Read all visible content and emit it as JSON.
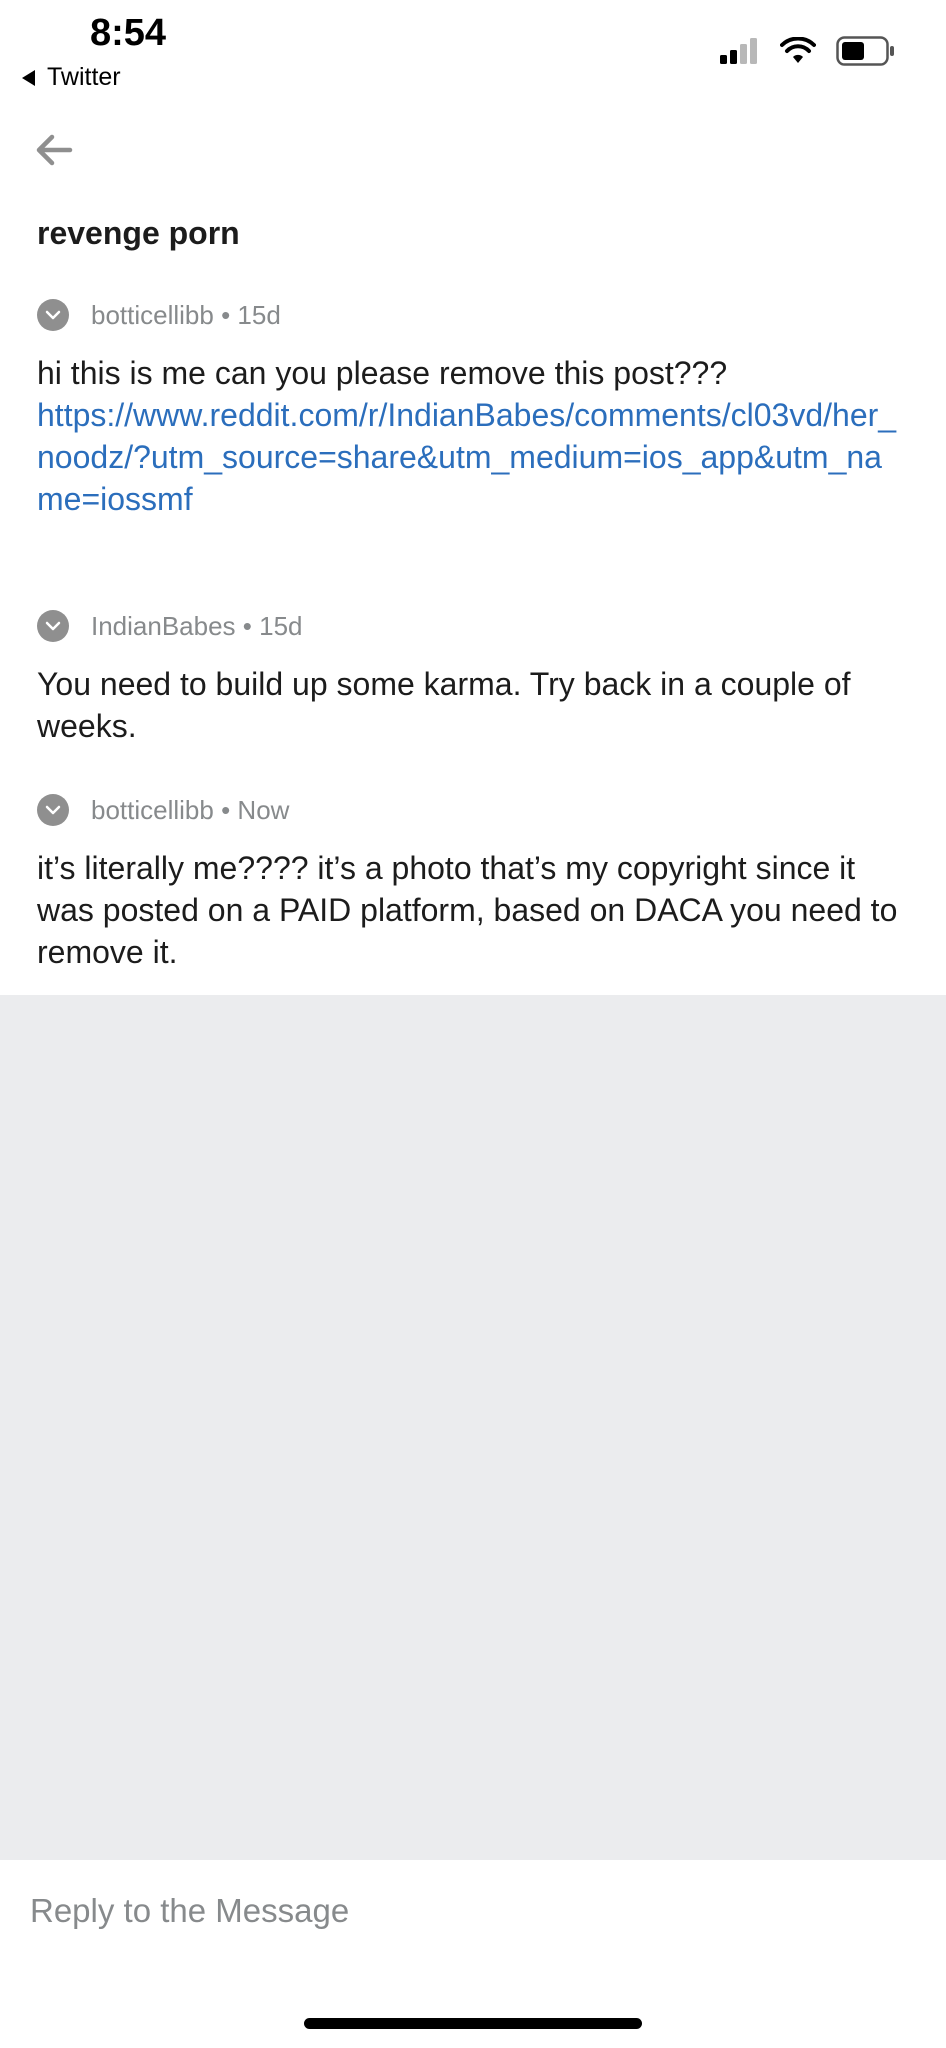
{
  "status_bar": {
    "time": "8:54",
    "back_app": "Twitter"
  },
  "icons": {
    "back": "arrow-left-icon",
    "signal": "cellular-signal-icon",
    "wifi": "wifi-icon",
    "battery": "battery-icon",
    "collapse": "chevron-down-icon"
  },
  "conversation": {
    "title": "revenge porn",
    "messages": [
      {
        "author": "botticellibb",
        "time": "15d",
        "text": "hi this is me can you please remove this post???",
        "link": "https://www.reddit.com/r/IndianBabes/comments/cl03vd/her_noodz/?utm_source=share&utm_medium=ios_app&utm_name=iossmf"
      },
      {
        "author": "IndianBabes",
        "time": "15d",
        "text": "You need to build up some karma. Try back in a couple of weeks."
      },
      {
        "author": "botticellibb",
        "time": "Now",
        "text": "it’s literally me???? it’s a photo that’s my copyright since it was posted on a PAID platform, based on DACA you need to remove it."
      }
    ]
  },
  "reply": {
    "placeholder": "Reply to the Message"
  },
  "colors": {
    "link": "#2b6ebc",
    "meta": "#878a8c",
    "empty_area": "#ebecee"
  }
}
